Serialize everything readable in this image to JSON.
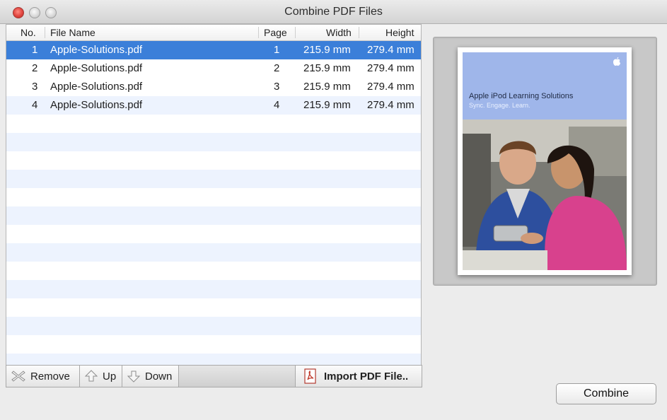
{
  "window": {
    "title": "Combine PDF Files"
  },
  "table": {
    "columns": {
      "no": "No.",
      "file": "File Name",
      "page": "Page",
      "width": "Width",
      "height": "Height"
    },
    "rows": [
      {
        "no": "1",
        "file": "Apple-Solutions.pdf",
        "page": "1",
        "width": "215.9 mm",
        "height": "279.4 mm",
        "selected": true
      },
      {
        "no": "2",
        "file": "Apple-Solutions.pdf",
        "page": "2",
        "width": "215.9 mm",
        "height": "279.4 mm",
        "selected": false
      },
      {
        "no": "3",
        "file": "Apple-Solutions.pdf",
        "page": "3",
        "width": "215.9 mm",
        "height": "279.4 mm",
        "selected": false
      },
      {
        "no": "4",
        "file": "Apple-Solutions.pdf",
        "page": "4",
        "width": "215.9 mm",
        "height": "279.4 mm",
        "selected": false
      }
    ]
  },
  "toolbar": {
    "remove": "Remove",
    "up": "Up",
    "down": "Down",
    "import": "Import PDF File.."
  },
  "preview": {
    "title": "Apple iPod Learning Solutions",
    "subtitle": "Sync. Engage. Learn."
  },
  "actions": {
    "combine": "Combine"
  },
  "colors": {
    "selection": "#3b7fd9",
    "stripe": "#edf3fe",
    "cover": "#9fb6ea"
  },
  "icons": [
    "close-button",
    "minimize-button",
    "zoom-button",
    "remove-icon",
    "up-arrow-icon",
    "down-arrow-icon",
    "pdf-icon",
    "apple-logo-icon"
  ]
}
